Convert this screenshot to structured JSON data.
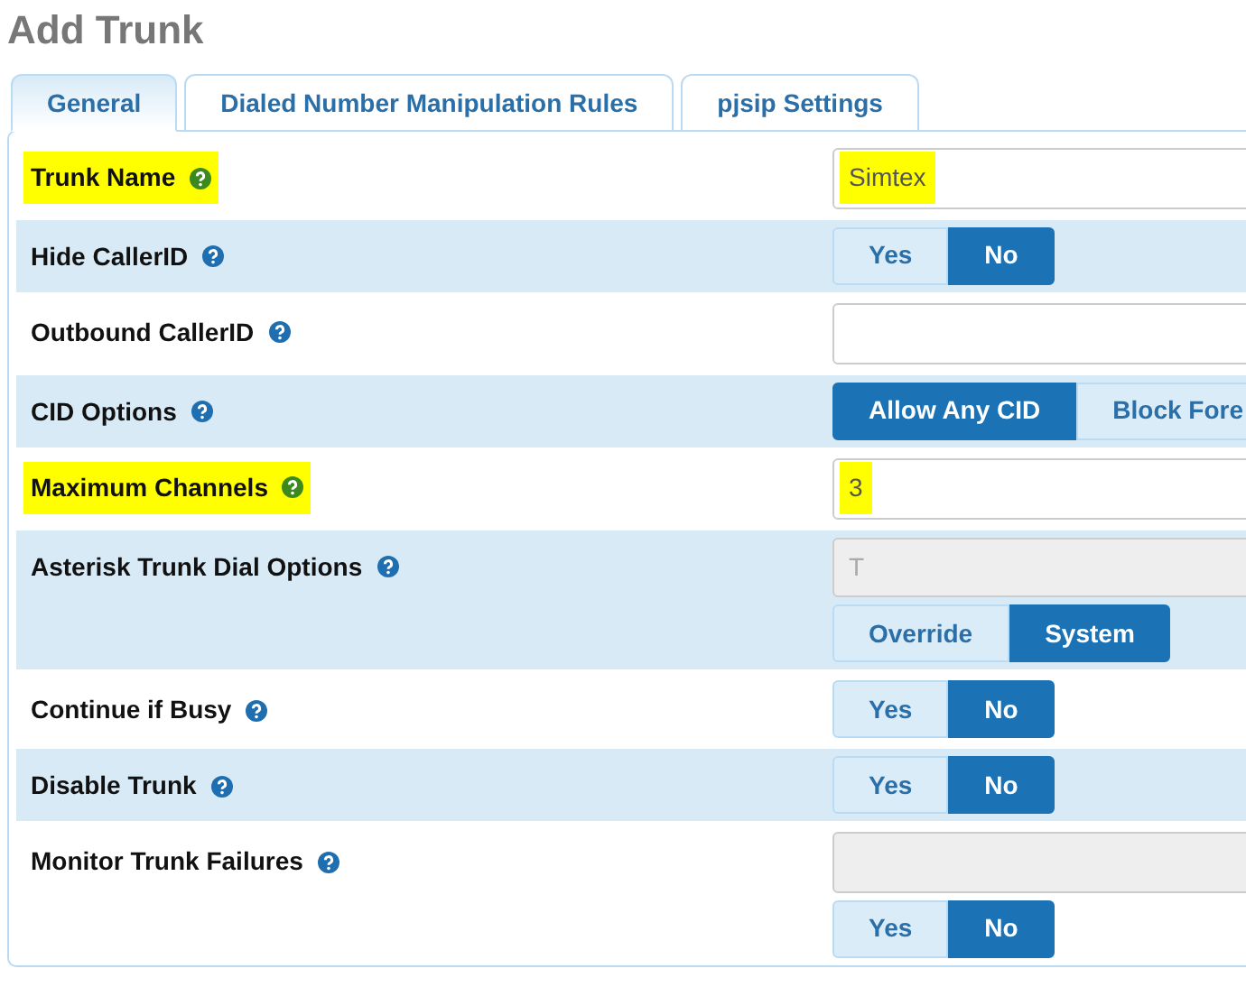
{
  "title": "Add Trunk",
  "tabs": [
    {
      "label": "General",
      "selected": true
    },
    {
      "label": "Dialed Number Manipulation Rules",
      "selected": false
    },
    {
      "label": "pjsip Settings",
      "selected": false
    }
  ],
  "rows": [
    {
      "label": "Trunk Name",
      "highlighted": true,
      "controls": [
        {
          "kind": "input",
          "value": "Simtex",
          "highlighted": true,
          "disabled": false
        }
      ]
    },
    {
      "label": "Hide CallerID",
      "highlighted": false,
      "controls": [
        {
          "kind": "toggle",
          "options": [
            {
              "label": "Yes",
              "selected": false
            },
            {
              "label": "No",
              "selected": true
            }
          ]
        }
      ]
    },
    {
      "label": "Outbound CallerID",
      "highlighted": false,
      "controls": [
        {
          "kind": "input",
          "disabled": false
        }
      ]
    },
    {
      "label": "CID Options",
      "highlighted": false,
      "controls": [
        {
          "kind": "toggle",
          "options": [
            {
              "label": "Allow Any CID",
              "selected": true
            },
            {
              "label": "Block Fore",
              "selected": false
            }
          ]
        }
      ]
    },
    {
      "label": "Maximum Channels",
      "highlighted": true,
      "controls": [
        {
          "kind": "input",
          "value": "3",
          "highlighted": true,
          "disabled": false
        }
      ]
    },
    {
      "label": "Asterisk Trunk Dial Options",
      "highlighted": false,
      "controls": [
        {
          "kind": "input",
          "placeholder": "T",
          "disabled": true
        },
        {
          "kind": "toggle",
          "options": [
            {
              "label": "Override",
              "selected": false
            },
            {
              "label": "System",
              "selected": true
            }
          ]
        }
      ]
    },
    {
      "label": "Continue if Busy",
      "highlighted": false,
      "controls": [
        {
          "kind": "toggle",
          "options": [
            {
              "label": "Yes",
              "selected": false
            },
            {
              "label": "No",
              "selected": true
            }
          ]
        }
      ]
    },
    {
      "label": "Disable Trunk",
      "highlighted": false,
      "controls": [
        {
          "kind": "toggle",
          "options": [
            {
              "label": "Yes",
              "selected": false
            },
            {
              "label": "No",
              "selected": true
            }
          ]
        }
      ]
    },
    {
      "label": "Monitor Trunk Failures",
      "highlighted": false,
      "controls": [
        {
          "kind": "input",
          "disabled": true
        },
        {
          "kind": "toggle",
          "options": [
            {
              "label": "Yes",
              "selected": false
            },
            {
              "label": "No",
              "selected": true
            }
          ]
        }
      ]
    }
  ]
}
